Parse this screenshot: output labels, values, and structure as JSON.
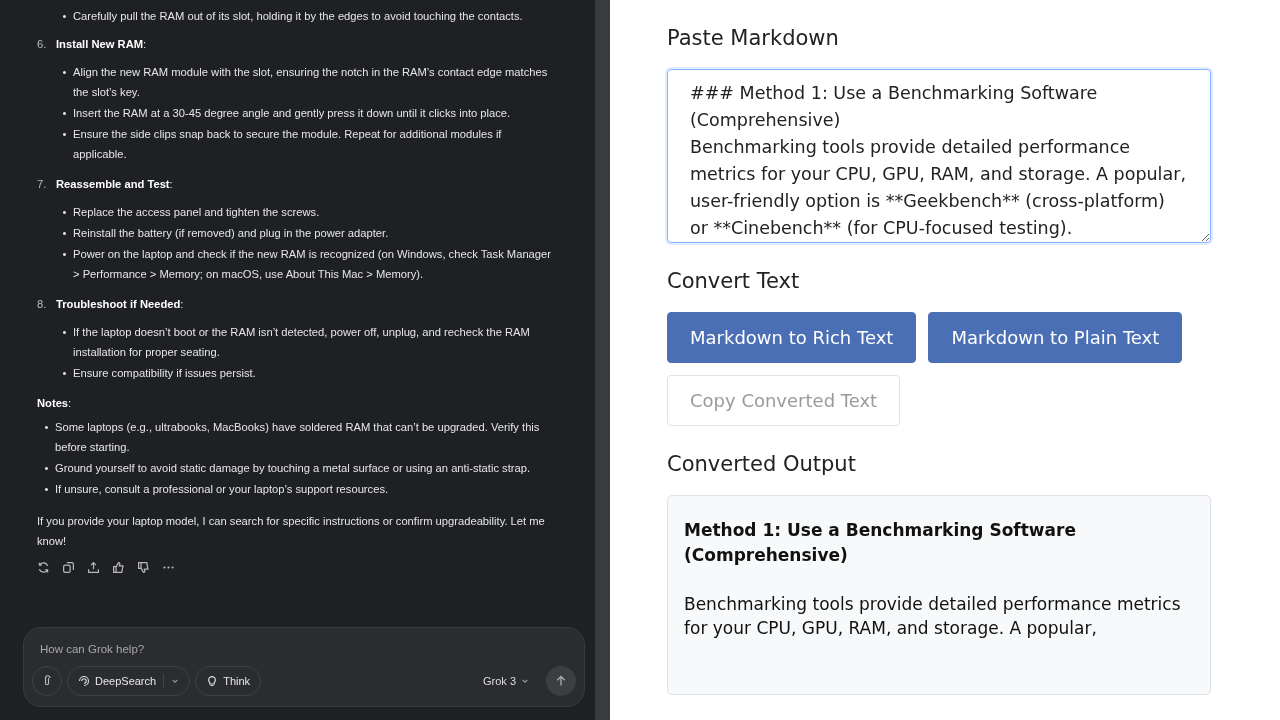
{
  "chat": {
    "continued_bullets": [
      {
        "marker": "•",
        "text": "Carefully pull the RAM out of its slot, holding it by the edges to avoid touching the contacts."
      }
    ],
    "steps": [
      {
        "number": "6.",
        "title": "**Install New RAM**:",
        "bullets": [
          {
            "marker": "•",
            "text": "Align the new RAM module with the slot, ensuring the notch in the RAM’s contact edge matches the slot’s key."
          },
          {
            "marker": "•",
            "text": "Insert the RAM at a 30-45 degree angle and gently press it down until it clicks into place."
          },
          {
            "marker": "•",
            "text": "Ensure the side clips snap back to secure the module. Repeat for additional modules if applicable."
          }
        ]
      },
      {
        "number": "7.",
        "title": "**Reassemble and Test**:",
        "bullets": [
          {
            "marker": "•",
            "text": "Replace the access panel and tighten the screws."
          },
          {
            "marker": "•",
            "text": "Reinstall the battery (if removed) and plug in the power adapter."
          },
          {
            "marker": "•",
            "text": "Power on the laptop and check if the new RAM is recognized (on Windows, check Task Manager > Performance > Memory; on macOS, use About This Mac > Memory)."
          }
        ]
      },
      {
        "number": "8.",
        "title": "**Troubleshoot if Needed**:",
        "bullets": [
          {
            "marker": "•",
            "text": "If the laptop doesn’t boot or the RAM isn’t detected, power off, unplug, and recheck the RAM installation for proper seating."
          },
          {
            "marker": "•",
            "text": "Ensure compatibility if issues persist."
          }
        ]
      }
    ],
    "notes_heading": "**Notes**:",
    "notes": [
      {
        "marker": "•",
        "text": "Some laptops (e.g., ultrabooks, MacBooks) have soldered RAM that can’t be upgraded. Verify this before starting."
      },
      {
        "marker": "•",
        "text": "Ground yourself to avoid static damage by touching a metal surface or using an anti-static strap."
      },
      {
        "marker": "•",
        "text": "If unsure, consult a professional or your laptop’s support resources."
      }
    ],
    "closing": "If you provide your laptop model, I can search for specific instructions or confirm upgradeability. Let me know!",
    "composer": {
      "placeholder": "How can Grok help?",
      "deepsearch": "DeepSearch",
      "think": "Think",
      "model": "Grok 3"
    }
  },
  "converter": {
    "paste_heading": "Paste Markdown",
    "markdown": "### Method 1: Use a Benchmarking Software (Comprehensive)\nBenchmarking tools provide detailed performance metrics for your CPU, GPU, RAM, and storage. A popular, user-friendly option is **Geekbench** (cross-platform) or **Cinebench** (for CPU-focused testing).",
    "convert_heading": "Convert Text",
    "buttons": [
      {
        "label": "Markdown to Rich Text",
        "kind": "primary",
        "disabled": false
      },
      {
        "label": "Markdown to Plain Text",
        "kind": "primary",
        "disabled": false
      },
      {
        "label": "Copy Converted Text",
        "kind": "secondary",
        "disabled": true
      }
    ],
    "output_heading": "Converted Output",
    "output": {
      "heading": "Method 1: Use a Benchmarking Software (Comprehensive)",
      "paragraph": "Benchmarking tools provide detailed performance metrics for your CPU, GPU, RAM, and storage. A popular,"
    }
  }
}
